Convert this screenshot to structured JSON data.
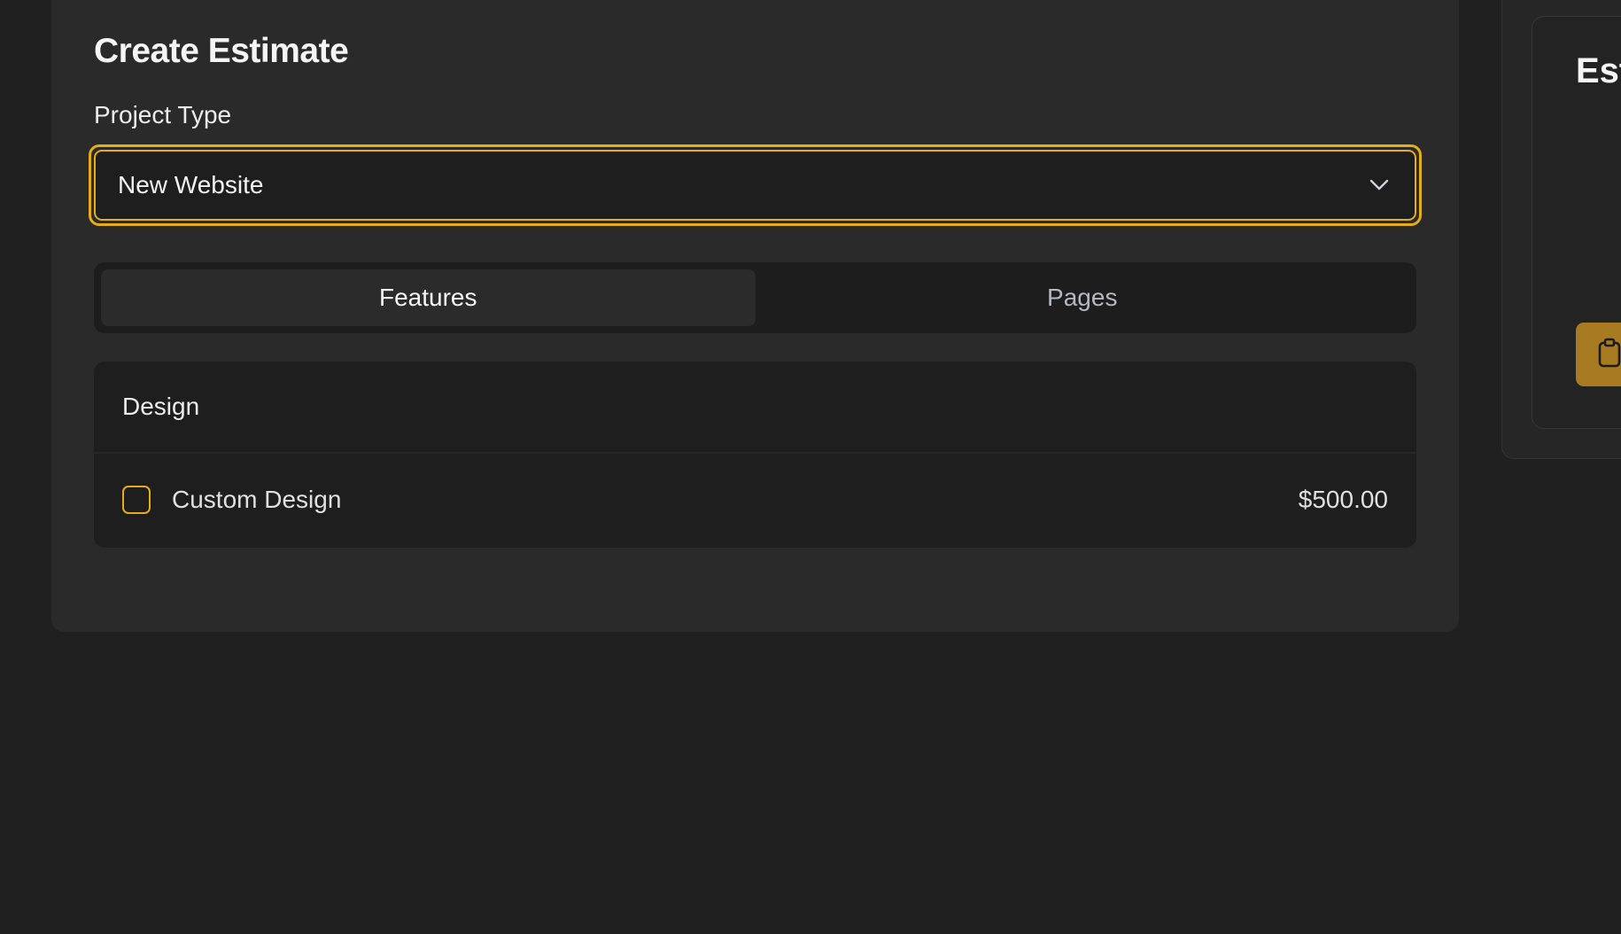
{
  "estimate_form": {
    "title": "Create Estimate",
    "project_type_label": "Project Type",
    "project_type_value": "New Website"
  },
  "tabs": [
    {
      "label": "Features",
      "active": true
    },
    {
      "label": "Pages",
      "active": false
    }
  ],
  "design_section": {
    "header": "Design",
    "items": [
      {
        "label": "Custom Design",
        "price": "$500.00",
        "checked": false
      }
    ]
  },
  "summary_panel": {
    "title": "Est",
    "copy_button_icon": "clipboard-icon"
  },
  "colors": {
    "accent": "#e6ad1a",
    "copy_button": "#a87a21",
    "background": "#202020",
    "card": "#2a2a2a"
  },
  "icons": {
    "select": "chevron-down-icon",
    "copy": "clipboard-icon"
  }
}
